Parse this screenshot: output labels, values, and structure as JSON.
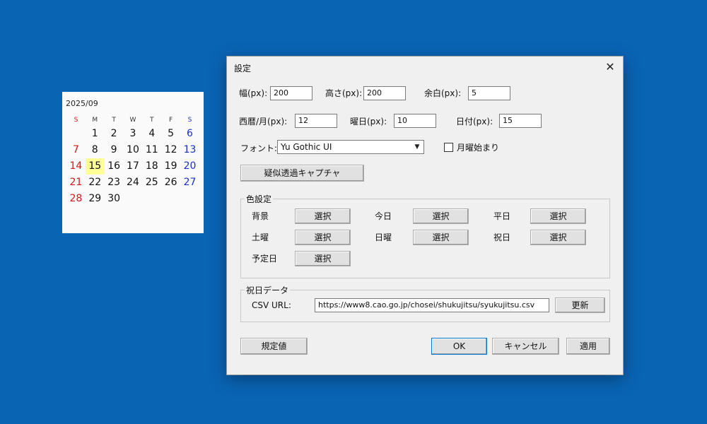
{
  "calendar": {
    "title": "2025/09",
    "dow": [
      "S",
      "M",
      "T",
      "W",
      "T",
      "F",
      "S"
    ],
    "weeks": [
      [
        "",
        "1",
        "2",
        "3",
        "4",
        "5",
        "6"
      ],
      [
        "7",
        "8",
        "9",
        "10",
        "11",
        "12",
        "13"
      ],
      [
        "14",
        "15",
        "16",
        "17",
        "18",
        "19",
        "20"
      ],
      [
        "21",
        "22",
        "23",
        "24",
        "25",
        "26",
        "27"
      ],
      [
        "28",
        "29",
        "30",
        "",
        "",
        "",
        ""
      ]
    ],
    "today": "15",
    "colors": {
      "sunday": "#d01818",
      "saturday": "#1830c8",
      "today_bg": "#ffff99"
    }
  },
  "dialog": {
    "title": "設定",
    "close_symbol": "✕",
    "width_label": "幅(px):",
    "width_value": "200",
    "height_label": "高さ(px):",
    "height_value": "200",
    "margin_label": "余白(px):",
    "margin_value": "5",
    "yearmonth_label": "西暦/月(px):",
    "yearmonth_value": "12",
    "weekday_label": "曜日(px):",
    "weekday_value": "10",
    "date_label": "日付(px):",
    "date_value": "15",
    "font_label": "フォント:",
    "font_value": "Yu Gothic UI",
    "monday_start_label": "月曜始まり",
    "pseudo_capture_label": "疑似透過キャプチャ",
    "color_group": {
      "title": "色設定",
      "select_label": "選択",
      "background": "背景",
      "today": "今日",
      "weekday": "平日",
      "saturday": "土曜",
      "sunday": "日曜",
      "holiday": "祝日",
      "scheduled": "予定日"
    },
    "holiday_group": {
      "title": "祝日データ",
      "csv_label": "CSV URL:",
      "csv_value": "https://www8.cao.go.jp/chosei/shukujitsu/syukujitsu.csv",
      "update_label": "更新"
    },
    "default_label": "規定値",
    "ok_label": "OK",
    "cancel_label": "キャンセル",
    "apply_label": "適用"
  }
}
